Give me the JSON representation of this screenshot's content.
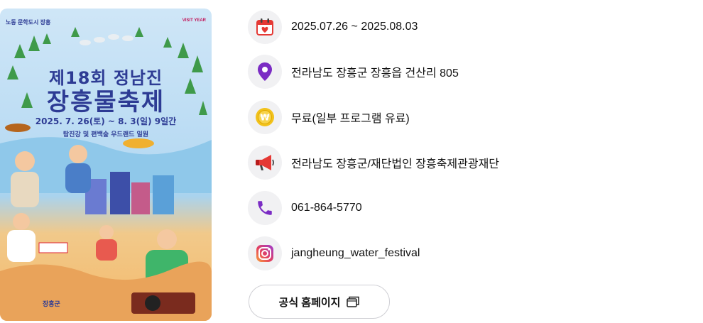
{
  "poster": {
    "top_left_logo": "노동 문학도시 장흥",
    "top_right_logo": "VISIT YEAR",
    "title_line1": "제18회 정남진",
    "title_line2": "장흥물축제",
    "dates": "2025. 7. 26(토) ~ 8. 3(일) 9일간",
    "venue": "탐진강 및 편백숲 우드랜드 일원",
    "footer": "장흥군"
  },
  "info": {
    "period": "2025.07.26 ~ 2025.08.03",
    "address": "전라남도 장흥군 장흥읍 건산리 805",
    "fee": "무료(일부 프로그램 유료)",
    "host": "전라남도 장흥군/재단법인 장흥축제관광재단",
    "phone": "061-864-5770",
    "instagram": "jangheung_water_festival"
  },
  "icons": {
    "period": "calendar-icon",
    "address": "location-pin-icon",
    "fee": "coin-icon",
    "host": "megaphone-icon",
    "phone": "phone-icon",
    "instagram": "instagram-icon"
  },
  "colors": {
    "pin": "#7b2cc4",
    "coin": "#f2c21b",
    "megaphone": "#e53935",
    "phone": "#7b2cc4",
    "calendar": "#e53935"
  },
  "homepage_button": {
    "label": "공식 홈페이지"
  }
}
